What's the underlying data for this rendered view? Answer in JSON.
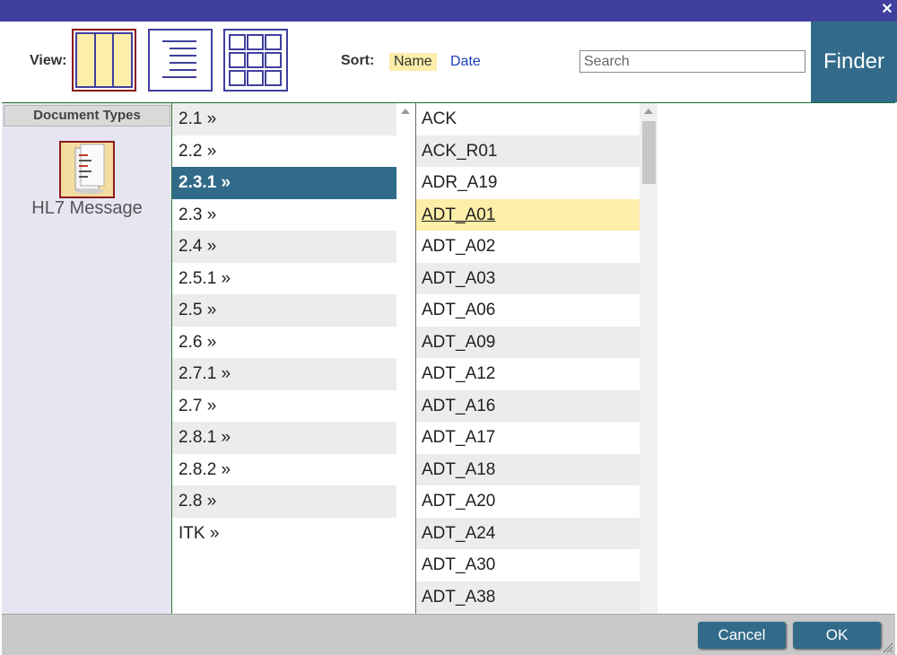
{
  "toolbar": {
    "view_label": "View:",
    "sort_label": "Sort:",
    "sort_name": "Name",
    "sort_date": "Date",
    "search_placeholder": "Search",
    "finder_label": "Finder"
  },
  "left_panel": {
    "header": "Document Types",
    "item_label": "HL7 Message"
  },
  "versions": [
    {
      "label": "2.1 »"
    },
    {
      "label": "2.2 »"
    },
    {
      "label": "2.3.1 »",
      "selected": true
    },
    {
      "label": "2.3 »"
    },
    {
      "label": "2.4 »"
    },
    {
      "label": "2.5.1 »"
    },
    {
      "label": "2.5 »"
    },
    {
      "label": "2.6 »"
    },
    {
      "label": "2.7.1 »"
    },
    {
      "label": "2.7 »"
    },
    {
      "label": "2.8.1 »"
    },
    {
      "label": "2.8.2 »"
    },
    {
      "label": "2.8 »"
    },
    {
      "label": "ITK »"
    }
  ],
  "messages": [
    {
      "label": "ACK"
    },
    {
      "label": "ACK_R01"
    },
    {
      "label": "ADR_A19"
    },
    {
      "label": "ADT_A01",
      "selected": true
    },
    {
      "label": "ADT_A02"
    },
    {
      "label": "ADT_A03"
    },
    {
      "label": "ADT_A06"
    },
    {
      "label": "ADT_A09"
    },
    {
      "label": "ADT_A12"
    },
    {
      "label": "ADT_A16"
    },
    {
      "label": "ADT_A17"
    },
    {
      "label": "ADT_A18"
    },
    {
      "label": "ADT_A20"
    },
    {
      "label": "ADT_A24"
    },
    {
      "label": "ADT_A30"
    },
    {
      "label": "ADT_A38"
    }
  ],
  "footer": {
    "cancel_label": "Cancel",
    "ok_label": "OK"
  },
  "colors": {
    "accent": "#316b89",
    "highlight": "#fdeea9",
    "title_bar": "#3f3f9e"
  }
}
